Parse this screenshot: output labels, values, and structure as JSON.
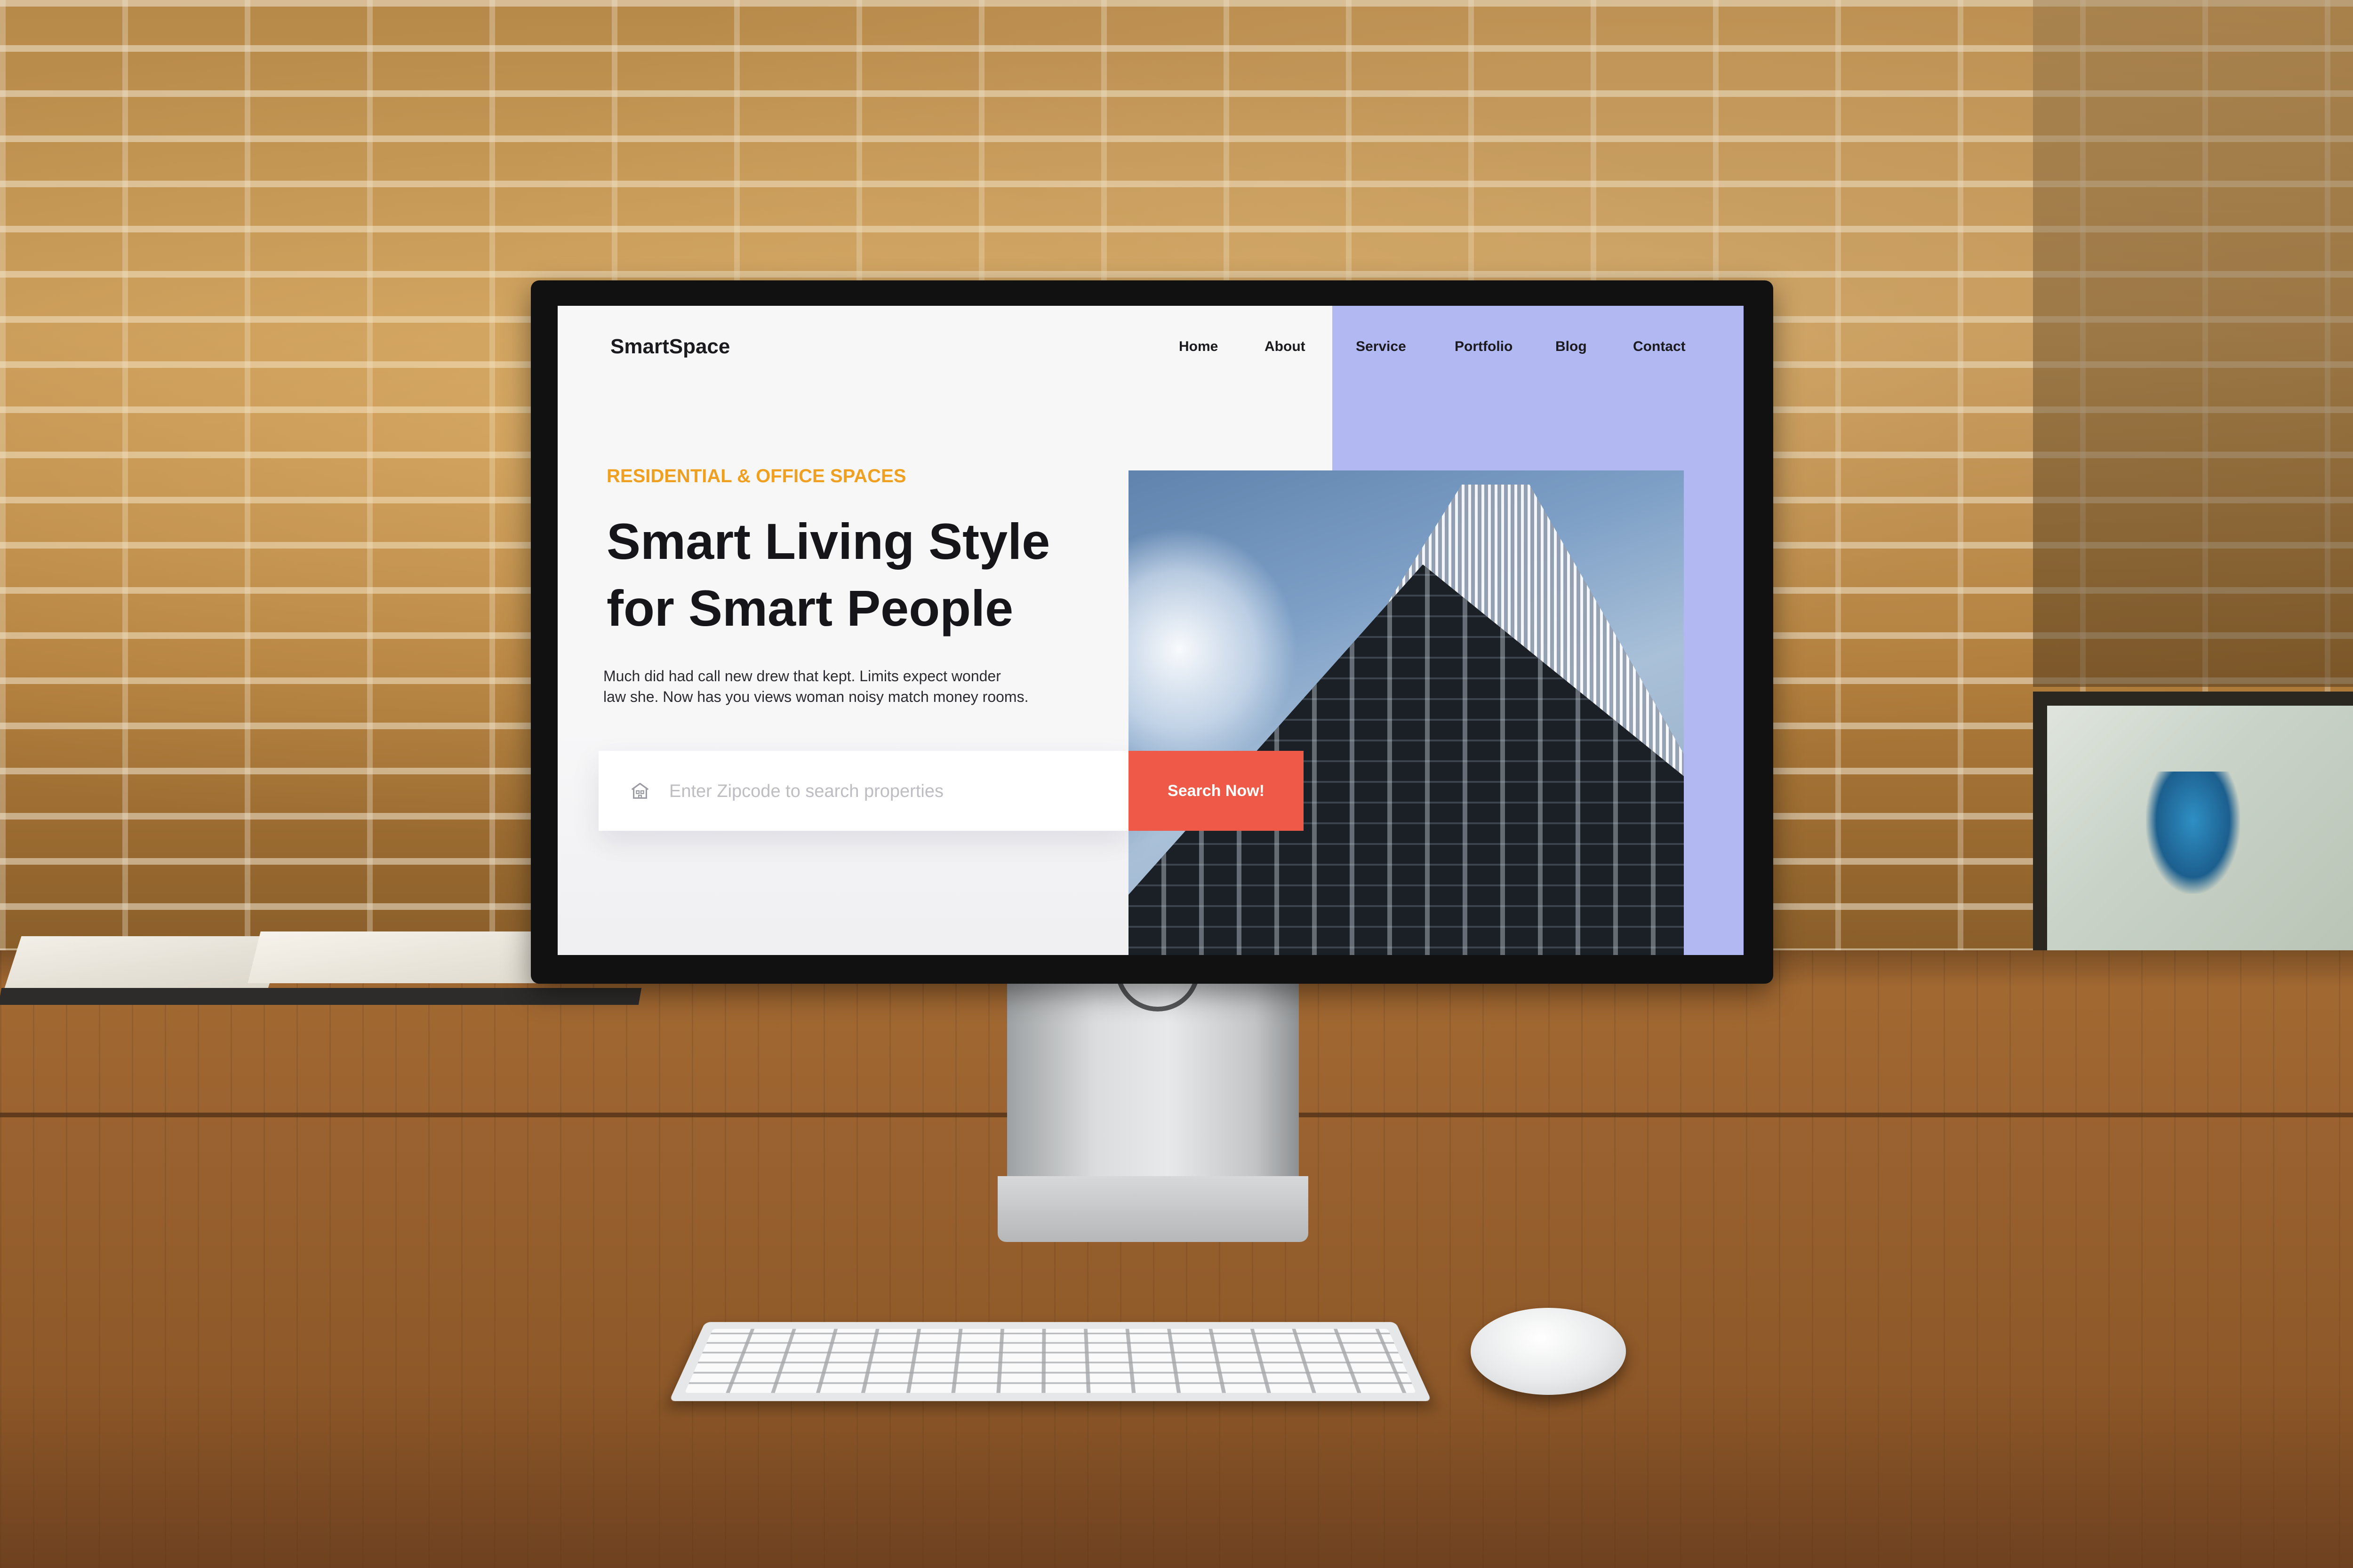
{
  "site": {
    "logo": "SmartSpace",
    "nav": {
      "home": "Home",
      "about": "About",
      "service": "Service",
      "portfolio": "Portfolio",
      "blog": "Blog",
      "contact": "Contact"
    },
    "hero": {
      "eyebrow": "RESIDENTIAL & OFFICE SPACES",
      "headline_line1": "Smart Living Style",
      "headline_line2": "for Smart People",
      "description_line1": "Much did had call new drew that kept. Limits expect wonder",
      "description_line2": "law she. Now has you views woman noisy match money rooms."
    },
    "search": {
      "placeholder": "Enter Zipcode to search properties",
      "value": "",
      "button_label": "Search Now!"
    },
    "colors": {
      "accent_panel": "#b2b8f2",
      "eyebrow": "#f0a020",
      "button": "#ee5a47"
    },
    "icons": {
      "search_field_icon": "house-icon"
    }
  }
}
